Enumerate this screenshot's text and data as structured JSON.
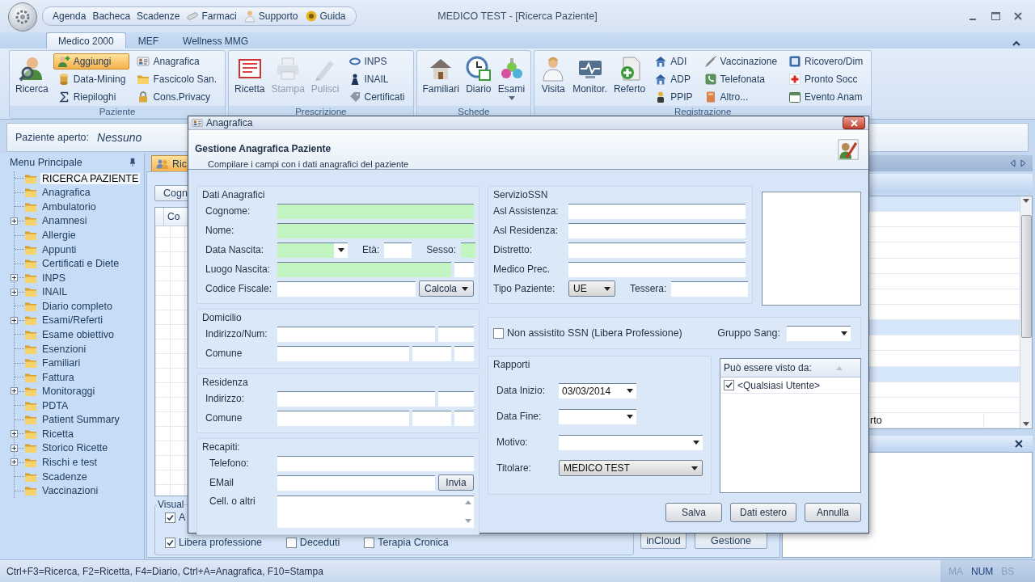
{
  "window": {
    "title": "MEDICO TEST - [Ricerca Paziente]"
  },
  "quick_access": [
    {
      "label": "Agenda",
      "kind": "plain"
    },
    {
      "label": "Bacheca",
      "kind": "plain"
    },
    {
      "label": "Scadenze",
      "kind": "plain"
    },
    {
      "label": "Farmaci",
      "kind": "with_icon"
    },
    {
      "label": "Supporto",
      "kind": "with_icon"
    },
    {
      "label": "Guida",
      "kind": "with_icon"
    }
  ],
  "ribbon_tabs": [
    {
      "label": "Medico 2000",
      "selected": true
    },
    {
      "label": "MEF",
      "selected": false
    },
    {
      "label": "Wellness MMG",
      "selected": false
    }
  ],
  "ribbon_groups": [
    {
      "title": "Paziente",
      "items": [
        {
          "label": "Ricerca",
          "kind": "large",
          "disabled": false,
          "menu": false
        },
        {
          "label": "Aggiungi",
          "kind": "small",
          "active": true,
          "disabled": false
        },
        {
          "label": "Data-Mining",
          "kind": "small",
          "active": false,
          "disabled": false
        },
        {
          "label": "Riepiloghi",
          "kind": "small",
          "active": false,
          "disabled": false
        },
        {
          "label": "Anagrafica",
          "kind": "small",
          "active": false,
          "disabled": false
        },
        {
          "label": "Fascicolo San.",
          "kind": "small",
          "active": false,
          "disabled": false
        },
        {
          "label": "Cons.Privacy",
          "kind": "small",
          "active": false,
          "disabled": false
        }
      ]
    },
    {
      "title": "Prescrizione",
      "items": [
        {
          "label": "Ricetta",
          "kind": "large",
          "disabled": false,
          "menu": false
        },
        {
          "label": "Stampa",
          "kind": "large",
          "disabled": true,
          "menu": false
        },
        {
          "label": "Pulisci",
          "kind": "large",
          "disabled": true,
          "menu": false
        },
        {
          "label": "INPS",
          "kind": "small",
          "active": false,
          "disabled": false
        },
        {
          "label": "INAIL",
          "kind": "small",
          "active": false,
          "disabled": false
        },
        {
          "label": "Certificati",
          "kind": "small",
          "active": false,
          "disabled": false
        }
      ]
    },
    {
      "title": "Schede",
      "items": [
        {
          "label": "Familiari",
          "kind": "large",
          "disabled": false,
          "menu": false
        },
        {
          "label": "Diario",
          "kind": "large",
          "disabled": false,
          "menu": false
        },
        {
          "label": "Esami",
          "kind": "large",
          "disabled": false,
          "menu": true
        }
      ]
    },
    {
      "title": "Registrazione",
      "items": [
        {
          "label": "Visita",
          "kind": "large",
          "disabled": false,
          "menu": false
        },
        {
          "label": "Monitor.",
          "kind": "large",
          "disabled": false,
          "menu": false
        },
        {
          "label": "Referto",
          "kind": "large",
          "disabled": false,
          "menu": false
        },
        {
          "label": "ADI",
          "kind": "small",
          "active": false,
          "disabled": false
        },
        {
          "label": "ADP",
          "kind": "small",
          "active": false,
          "disabled": false
        },
        {
          "label": "PPIP",
          "kind": "small",
          "active": false,
          "disabled": false
        },
        {
          "label": "Vaccinazione",
          "kind": "small",
          "active": false,
          "disabled": false
        },
        {
          "label": "Telefonata",
          "kind": "small",
          "active": false,
          "disabled": false
        },
        {
          "label": "Altro...",
          "kind": "small",
          "active": false,
          "disabled": false
        },
        {
          "label": "Ricovero/Dim",
          "kind": "small",
          "active": false,
          "disabled": false
        },
        {
          "label": "Pronto Socc",
          "kind": "small",
          "active": false,
          "disabled": false
        },
        {
          "label": "Evento Anam",
          "kind": "small",
          "active": false,
          "disabled": false
        }
      ]
    }
  ],
  "patient_bar": {
    "label": "Paziente aperto:",
    "value": "Nessuno"
  },
  "sidebar": {
    "title": "Menu Principale",
    "items": [
      {
        "label": "RICERCA PAZIENTE",
        "selected": true,
        "expandable": false
      },
      {
        "label": "Anagrafica",
        "selected": false,
        "expandable": false
      },
      {
        "label": "Ambulatorio",
        "selected": false,
        "expandable": false
      },
      {
        "label": "Anamnesi",
        "selected": false,
        "expandable": true
      },
      {
        "label": "Allergie",
        "selected": false,
        "expandable": false
      },
      {
        "label": "Appunti",
        "selected": false,
        "expandable": false
      },
      {
        "label": "Certificati e Diete",
        "selected": false,
        "expandable": false
      },
      {
        "label": "INPS",
        "selected": false,
        "expandable": true
      },
      {
        "label": "INAIL",
        "selected": false,
        "expandable": true
      },
      {
        "label": "Diario completo",
        "selected": false,
        "expandable": false
      },
      {
        "label": "Esami/Referti",
        "selected": false,
        "expandable": true
      },
      {
        "label": "Esame obiettivo",
        "selected": false,
        "expandable": false
      },
      {
        "label": "Esenzioni",
        "selected": false,
        "expandable": false
      },
      {
        "label": "Familiari",
        "selected": false,
        "expandable": false
      },
      {
        "label": "Fattura",
        "selected": false,
        "expandable": false
      },
      {
        "label": "Monitoraggi",
        "selected": false,
        "expandable": true
      },
      {
        "label": "PDTA",
        "selected": false,
        "expandable": false
      },
      {
        "label": "Patient Summary",
        "selected": false,
        "expandable": false
      },
      {
        "label": "Ricetta",
        "selected": false,
        "expandable": true
      },
      {
        "label": "Storico Ricette",
        "selected": false,
        "expandable": true
      },
      {
        "label": "Rischi e test",
        "selected": false,
        "expandable": true
      },
      {
        "label": "Scadenze",
        "selected": false,
        "expandable": false
      },
      {
        "label": "Vaccinazioni",
        "selected": false,
        "expandable": false
      }
    ]
  },
  "main": {
    "tab": {
      "label": "Ric",
      "selected": true
    },
    "search_button": "Cogn",
    "column_header": "Co",
    "filter_group": {
      "title": "Visual",
      "rows": [
        [
          {
            "label": "A",
            "checked": true
          }
        ],
        [
          {
            "label": "Libera professione",
            "checked": true
          },
          {
            "label": "Deceduti",
            "checked": false
          },
          {
            "label": "Terapia Cronica",
            "checked": false
          }
        ]
      ]
    },
    "buttons": [
      "inCloud",
      "Gestione"
    ]
  },
  "side_panel": {
    "cell_text": "rto"
  },
  "dialog": {
    "title": "Anagrafica",
    "heading": "Gestione Anagrafica Paziente",
    "subheading": "Compilare i campi con i dati anagrafici del paziente",
    "left_groups": [
      {
        "title": "Dati Anagrafici",
        "rows": [
          {
            "label": "Cognome:",
            "kind": "text",
            "fields": [
              {
                "kind": "input",
                "mandatory": true
              }
            ]
          },
          {
            "label": "Nome:",
            "kind": "text",
            "fields": [
              {
                "kind": "input",
                "mandatory": true
              }
            ]
          },
          {
            "label": "Data Nascita:",
            "kind": "birth",
            "fields": [
              {
                "kind": "combo",
                "mandatory": true
              },
              {
                "kind": "input",
                "label": "Età:",
                "mandatory": false
              },
              {
                "kind": "input",
                "label": "Sesso:",
                "mandatory": true
              }
            ]
          },
          {
            "label": "Luogo Nascita:",
            "kind": "place",
            "fields": [
              {
                "kind": "input",
                "mandatory": true
              },
              {
                "kind": "input",
                "mandatory": false
              }
            ]
          },
          {
            "label": "Codice Fiscale:",
            "kind": "fiscal",
            "fields": [
              {
                "kind": "input",
                "mandatory": false
              },
              {
                "kind": "button",
                "text": "Calcola",
                "menu": true
              }
            ]
          }
        ]
      },
      {
        "title": "Domicilio",
        "rows": [
          {
            "label": "Indirizzo/Num:",
            "kind": "address",
            "fields": [
              {
                "kind": "input",
                "mandatory": false
              },
              {
                "kind": "input",
                "mandatory": false
              }
            ]
          },
          {
            "label": "Comune",
            "kind": "town",
            "fields": [
              {
                "kind": "input",
                "mandatory": false
              },
              {
                "kind": "input",
                "mandatory": false
              },
              {
                "kind": "input",
                "mandatory": false
              }
            ]
          }
        ]
      },
      {
        "title": "Residenza",
        "rows": [
          {
            "label": "Indirizzo:",
            "kind": "address",
            "fields": [
              {
                "kind": "input",
                "mandatory": false
              },
              {
                "kind": "input",
                "mandatory": false
              }
            ]
          },
          {
            "label": "Comune",
            "kind": "town",
            "fields": [
              {
                "kind": "input",
                "mandatory": false
              },
              {
                "kind": "input",
                "mandatory": false
              },
              {
                "kind": "input",
                "mandatory": false
              }
            ]
          }
        ]
      },
      {
        "title": "Recapiti:",
        "rows": [
          {
            "label": "Telefono:",
            "kind": "text",
            "fields": [
              {
                "kind": "input",
                "mandatory": false
              }
            ]
          },
          {
            "label": "EMail",
            "kind": "email",
            "fields": [
              {
                "kind": "input",
                "mandatory": false
              },
              {
                "kind": "button",
                "text": "Invia",
                "menu": false
              }
            ]
          },
          {
            "label": "Cell. o altri",
            "kind": "memo",
            "fields": [
              {
                "kind": "memo"
              }
            ]
          }
        ]
      }
    ],
    "ssn": {
      "title": "ServizioSSN",
      "rows": [
        {
          "label": "Asl Assistenza:",
          "kind": "ssn",
          "fields": [
            {
              "kind": "input",
              "mandatory": false
            }
          ]
        },
        {
          "label": "Asl Residenza:",
          "kind": "ssn",
          "fields": [
            {
              "kind": "input",
              "mandatory": false
            }
          ]
        },
        {
          "label": "Distretto:",
          "kind": "ssn",
          "fields": [
            {
              "kind": "input",
              "mandatory": false
            }
          ]
        },
        {
          "label": "Medico Prec.",
          "kind": "ssn",
          "fields": [
            {
              "kind": "input",
              "mandatory": false
            }
          ]
        },
        {
          "label": "Tipo Paziente:",
          "kind": "patient_type",
          "fields": [
            {
              "kind": "select",
              "value": "UE"
            },
            {
              "kind": "input",
              "label": "Tessera:",
              "mandatory": false
            }
          ]
        }
      ]
    },
    "non_ssn": {
      "label": "Non assistito SSN (Libera Professione)",
      "checked": false
    },
    "blood_group": {
      "label": "Gruppo Sang:"
    },
    "rapporti": {
      "title": "Rapporti",
      "rows": [
        {
          "label": "Data Inizio:",
          "kind": "date",
          "fields": [
            {
              "kind": "combo",
              "value": "03/03/2014",
              "mandatory": false
            }
          ]
        },
        {
          "label": "Data Fine:",
          "kind": "date",
          "fields": [
            {
              "kind": "combo",
              "mandatory": false
            }
          ]
        },
        {
          "label": "Motivo:",
          "kind": "wide_combo",
          "fields": [
            {
              "kind": "combo",
              "mandatory": false
            }
          ]
        },
        {
          "label": "Titolare:",
          "kind": "wide_combo",
          "fields": [
            {
              "kind": "select",
              "value": "MEDICO TEST"
            }
          ]
        }
      ]
    },
    "visibility": {
      "header": "Può essere visto da:",
      "items": [
        {
          "label": "<Qualsiasi Utente>",
          "checked": true
        }
      ]
    },
    "buttons": [
      "Salva",
      "Dati estero",
      "Annulla"
    ]
  },
  "status_bar": {
    "text": "Ctrl+F3=Ricerca, F2=Ricetta, F4=Diario, Ctrl+A=Anagrafica, F10=Stampa",
    "indicators": [
      {
        "label": "MA",
        "on": false
      },
      {
        "label": "NUM",
        "on": true
      },
      {
        "label": "BS",
        "on": false
      }
    ]
  }
}
